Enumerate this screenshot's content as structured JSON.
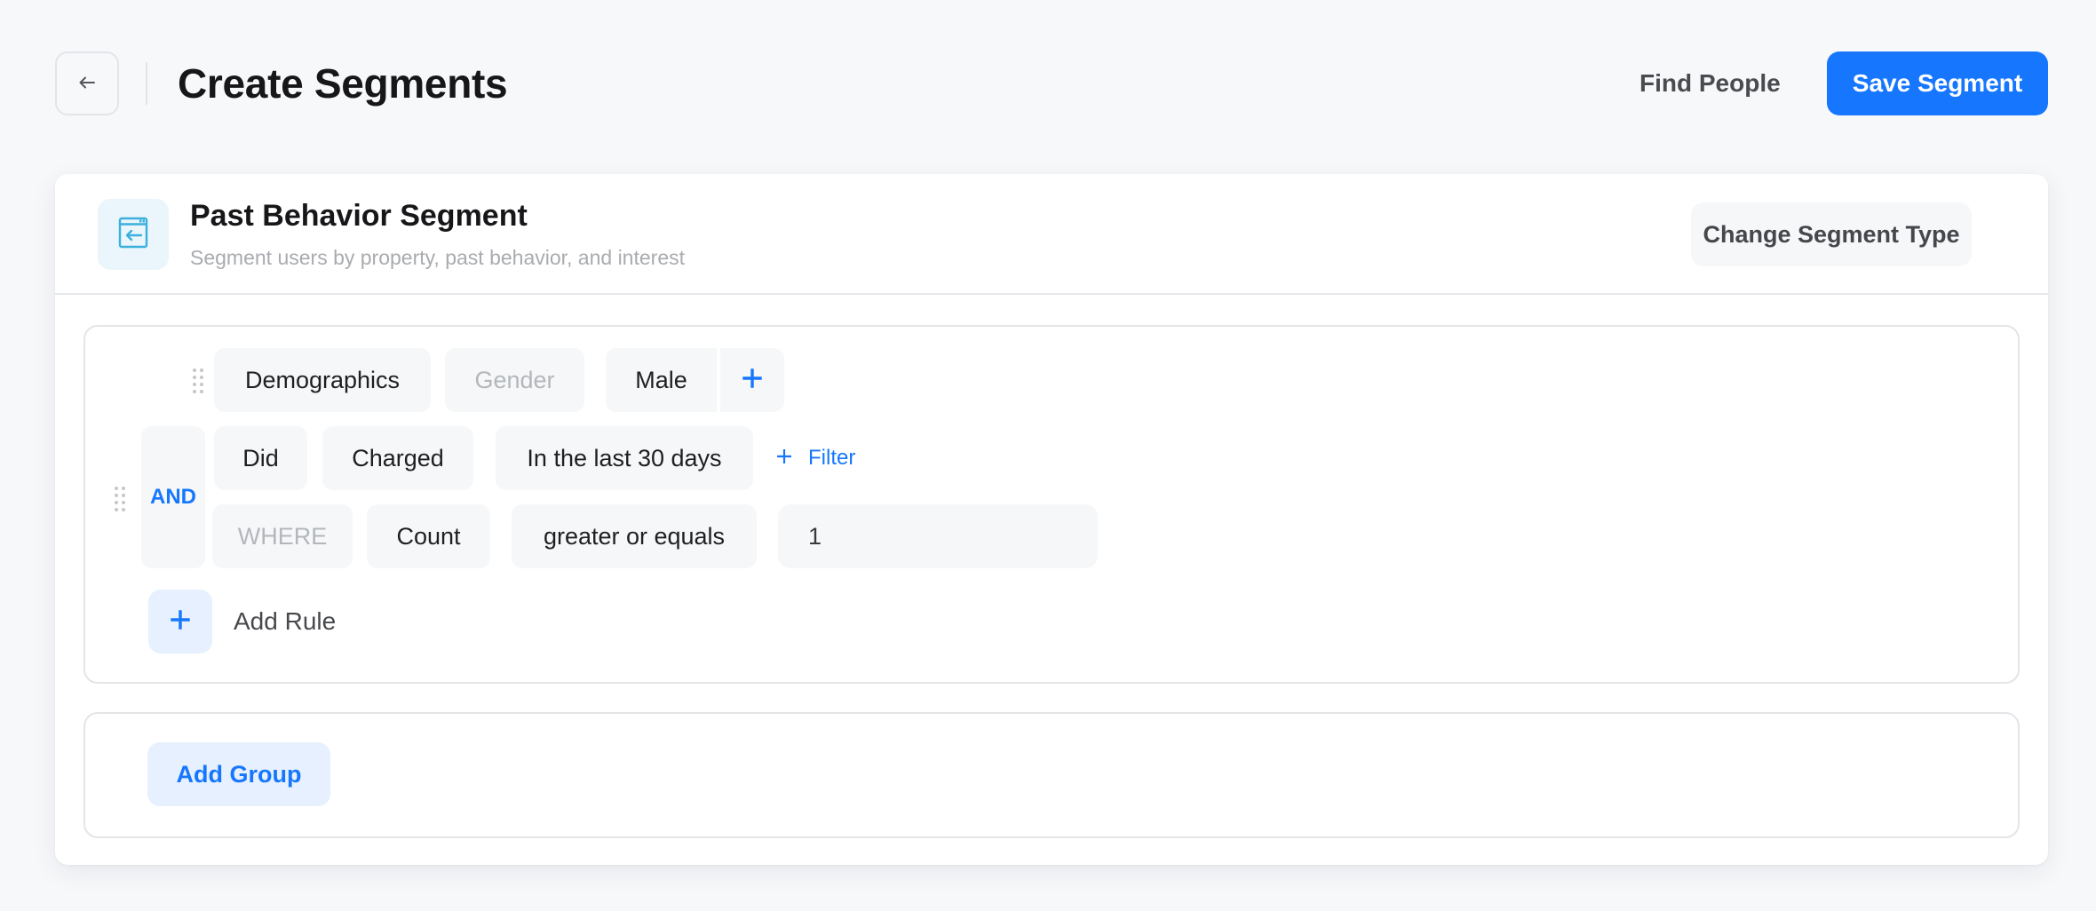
{
  "header": {
    "back_icon": "arrow-left-icon",
    "title": "Create Segments",
    "find_people_label": "Find People",
    "save_label": "Save Segment"
  },
  "segment_type": {
    "icon": "browser-window-arrow-left-icon",
    "title": "Past Behavior Segment",
    "subtitle": "Segment users by property, past behavior, and interest",
    "change_label": "Change Segment Type"
  },
  "group": {
    "demographics_rule": {
      "category": "Demographics",
      "property_placeholder": "Gender",
      "value": "Male",
      "add_value_icon": "plus-icon"
    },
    "operator": "AND",
    "behavior_rule": {
      "action": "Did",
      "event": "Charged",
      "time_range": "In the last 30 days",
      "filter_label": "Filter",
      "where_placeholder": "WHERE",
      "aggregate": "Count",
      "comparator": "greater or equals",
      "threshold": "1"
    },
    "add_rule_label": "Add Rule"
  },
  "add_group_label": "Add Group",
  "colors": {
    "accent": "#1677fe",
    "icon_accent": "#3bb0dc",
    "background": "#f7f8fa",
    "chip_background": "#f6f7f9",
    "accent_soft": "#e6f0fe"
  }
}
